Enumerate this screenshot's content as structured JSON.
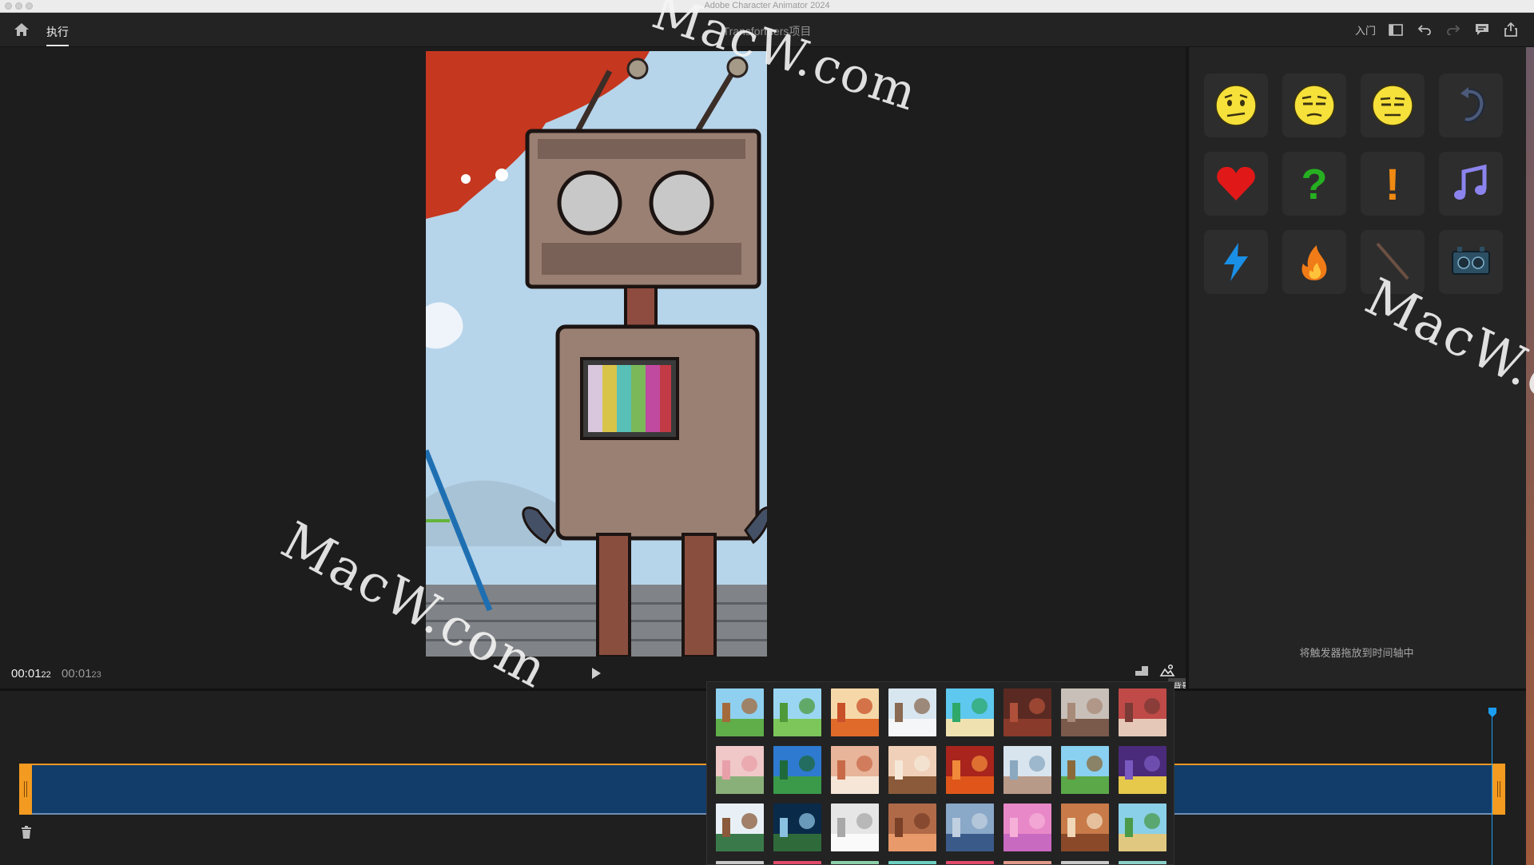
{
  "window": {
    "title": "Adobe Character Animator 2024"
  },
  "toolbar": {
    "tab_perform": "执行",
    "project_title": "Transformers项目",
    "learn_label": "入门"
  },
  "stage": {
    "current_time": "00:01",
    "current_frames": "22",
    "duration_time": "00:01",
    "duration_frames": "23",
    "background_tooltip": "背景"
  },
  "triggers": {
    "buttons": [
      {
        "name": "emoji-worried-icon",
        "glyph": "emoji"
      },
      {
        "name": "emoji-skeptical-icon",
        "glyph": "emoji"
      },
      {
        "name": "emoji-unamused-icon",
        "glyph": "emoji"
      },
      {
        "name": "loop-arrow-icon",
        "glyph": "loop"
      },
      {
        "name": "heart-icon",
        "glyph": "heart"
      },
      {
        "name": "question-mark-icon",
        "glyph": "?"
      },
      {
        "name": "exclamation-mark-icon",
        "glyph": "!"
      },
      {
        "name": "music-note-icon",
        "glyph": "note"
      },
      {
        "name": "lightning-icon",
        "glyph": "bolt"
      },
      {
        "name": "fire-icon",
        "glyph": "fire"
      },
      {
        "name": "stick-icon",
        "glyph": "stick"
      },
      {
        "name": "robot-head-icon",
        "glyph": "robot"
      }
    ],
    "hint": "将触发器拖放到时间轴中"
  },
  "background_picker": {
    "thumbnails": [
      "forest-path",
      "green-meadow",
      "autumn-trees",
      "winter-trees",
      "tropical-beach",
      "red-canyon",
      "city-street",
      "brick-diner",
      "pink-valley",
      "blue-green-hills",
      "living-room-frame",
      "living-room-armchair",
      "red-desert-sunset",
      "office-desk",
      "park-trees",
      "purple-night-city",
      "snowy-cabin",
      "stadium-lights",
      "white-studio",
      "wooden-room-arch",
      "blue-city",
      "pink-planet",
      "door-room",
      "yellow-desert-cactus"
    ]
  },
  "watermark": {
    "text": "MacW.com"
  },
  "colors": {
    "accent_orange": "#f39a20",
    "track_blue": "#123d6b",
    "playhead_blue": "#1b9ef2"
  }
}
